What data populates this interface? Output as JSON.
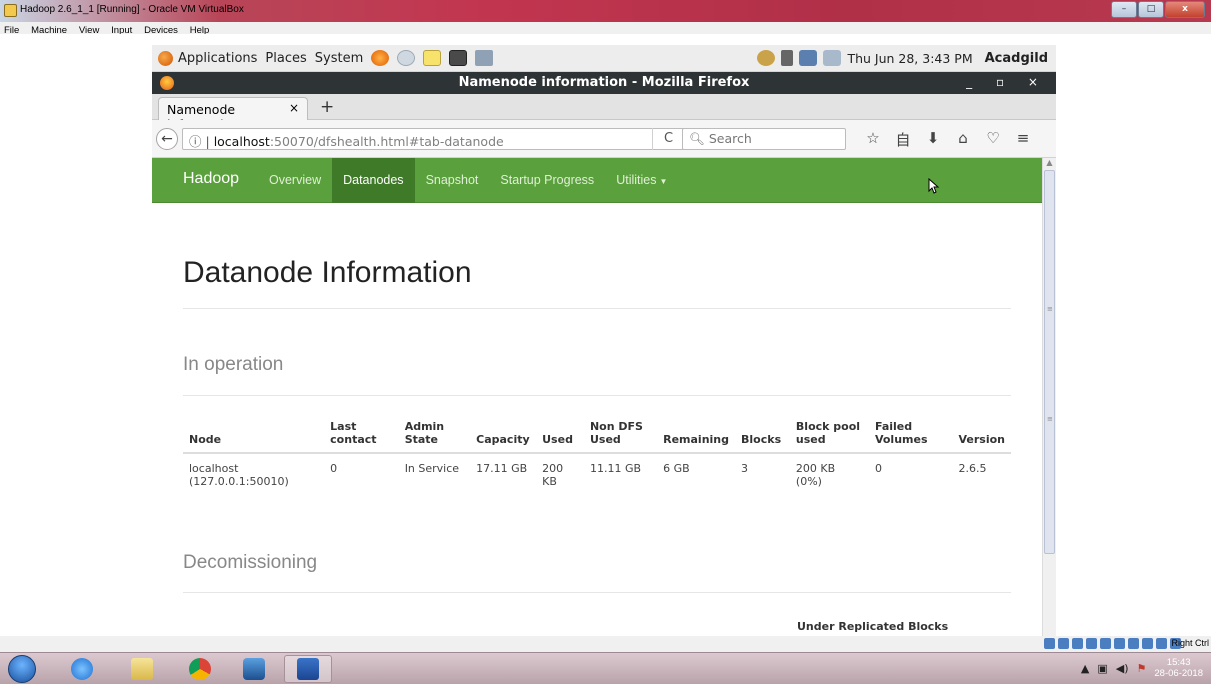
{
  "vbox": {
    "title": "Hadoop 2.6_1_1 [Running] - Oracle VM VirtualBox",
    "menu": [
      "File",
      "Machine",
      "View",
      "Input",
      "Devices",
      "Help"
    ],
    "controls": [
      "–",
      "□",
      "x"
    ],
    "host_key": "Right Ctrl"
  },
  "gnome": {
    "menus": [
      "Applications",
      "Places",
      "System"
    ],
    "clock": "Thu Jun 28,  3:43 PM",
    "user": "Acadgild"
  },
  "firefox": {
    "title": "Namenode information - Mozilla Firefox",
    "window_controls": "_ ▫ ×",
    "tab_label": "Namenode information",
    "tab_close": "×",
    "new_tab": "+",
    "url_host": "localhost",
    "url_rest": ":50070/dfshealth.html#tab-datanode",
    "search_placeholder": "Search",
    "back": "←",
    "reload": "C",
    "nav_icons": [
      "☆",
      "自",
      "⬇",
      "⌂",
      "♡",
      "≡"
    ]
  },
  "hadoop": {
    "brand": "Hadoop",
    "nav": [
      "Overview",
      "Datanodes",
      "Snapshot",
      "Startup Progress",
      "Utilities"
    ],
    "active_nav": "Datanodes",
    "page_title": "Datanode Information",
    "in_operation": "In operation",
    "decommissioning": "Decomissioning",
    "under_replicated": "Under Replicated Blocks",
    "table": {
      "headers": [
        "Node",
        "Last contact",
        "Admin State",
        "Capacity",
        "Used",
        "Non DFS Used",
        "Remaining",
        "Blocks",
        "Block pool used",
        "Failed Volumes",
        "Version"
      ],
      "rows": [
        [
          "localhost (127.0.0.1:50010)",
          "0",
          "In Service",
          "17.11 GB",
          "200 KB",
          "11.11 GB",
          "6 GB",
          "3",
          "200 KB (0%)",
          "0",
          "2.6.5"
        ]
      ]
    }
  },
  "taskbar": {
    "time": "15:43",
    "date": "28-06-2018"
  },
  "colors": {
    "hadoop_green": "#5aa03c",
    "hadoop_active": "#3f7a29",
    "ff_titlebar": "#2e3436"
  }
}
